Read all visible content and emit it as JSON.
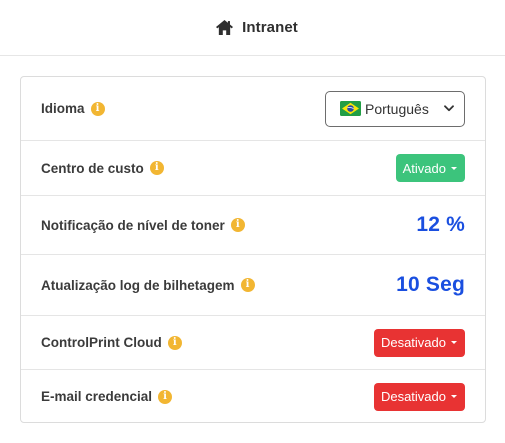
{
  "header": {
    "title": "Intranet",
    "icon": "home-icon"
  },
  "settings": {
    "idioma": {
      "label": "Idioma",
      "value": "Português",
      "flag": "brazil-flag-icon"
    },
    "centro_custo": {
      "label": "Centro de custo",
      "value": "Ativado",
      "color": "#3cc47c"
    },
    "toner": {
      "label": "Notificação de nível de toner",
      "value": "12 %"
    },
    "bilhetagem": {
      "label": "Atualização log de bilhetagem",
      "value": "10 Seg"
    },
    "cloud": {
      "label": "ControlPrint Cloud",
      "value": "Desativado",
      "color": "#e83333"
    },
    "email": {
      "label": "E-mail credencial",
      "value": "Desativado",
      "color": "#e83333"
    }
  },
  "colors": {
    "accent_blue": "#1a4fe0",
    "info_yellow": "#f2b632"
  }
}
